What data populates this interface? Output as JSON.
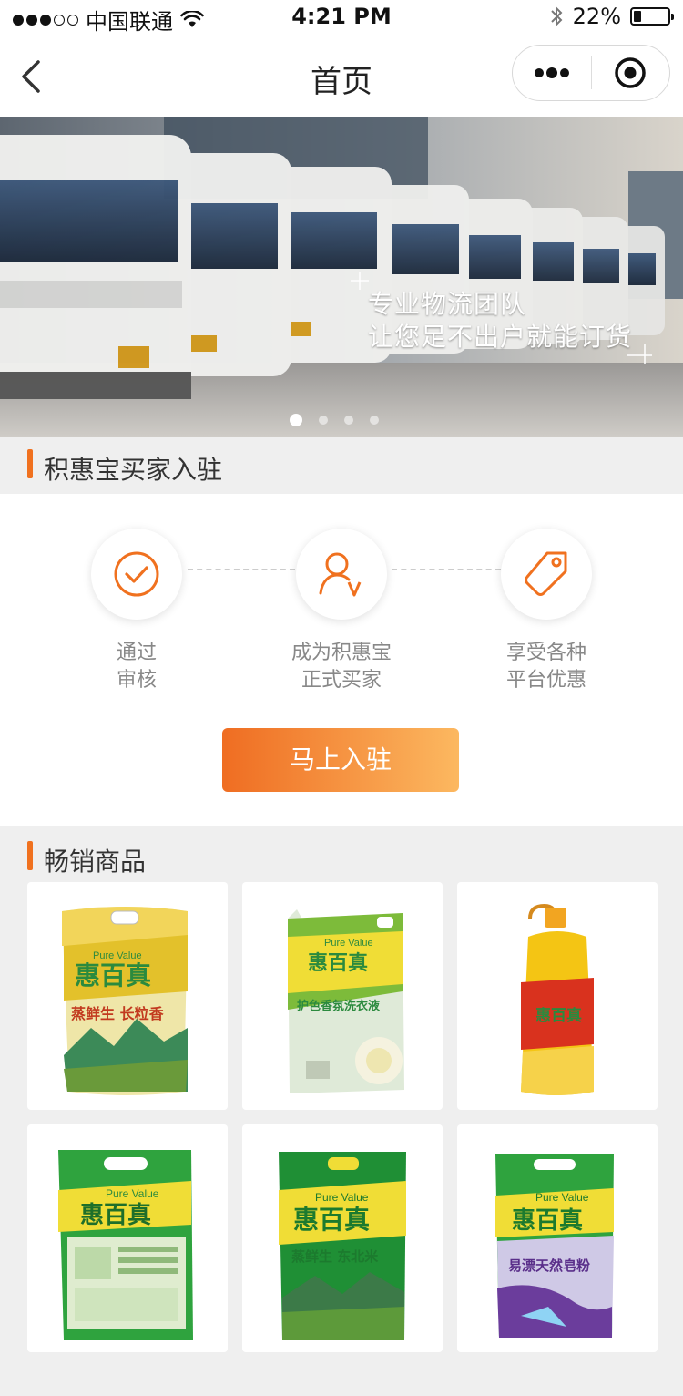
{
  "status_bar": {
    "carrier": "中国联通",
    "time": "4:21 PM",
    "battery_percent": "22%",
    "battery_level": 0.22,
    "signal_bars": 3,
    "signal_total": 5
  },
  "navbar": {
    "title": "首页",
    "back_icon": "chevron-left-icon",
    "more_icon": "more-dots-icon",
    "close_icon": "target-icon"
  },
  "banner": {
    "line1": "专业物流团队",
    "line2": "让您足不出户就能订货",
    "slide_count": 4,
    "active_index": 0
  },
  "join_section": {
    "title": "积惠宝买家入驻",
    "steps": [
      {
        "icon": "check-circle-icon",
        "line1": "通过",
        "line2": "审核"
      },
      {
        "icon": "user-v-icon",
        "line1": "成为积惠宝",
        "line2": "正式买家"
      },
      {
        "icon": "price-tag-icon",
        "line1": "享受各种",
        "line2": "平台优惠"
      }
    ],
    "button_label": "马上入驻"
  },
  "products_section": {
    "title": "畅销商品",
    "items": [
      {
        "kind": "rice-bag",
        "brand_en": "Pure Value",
        "brand": "惠百真",
        "label": "蒸鲜生 长粒香",
        "accent": "#c23a1f"
      },
      {
        "kind": "pouch",
        "brand_en": "Pure Value",
        "brand": "惠百真",
        "label": "护色香氛洗衣液",
        "accent": "#2b8a3e"
      },
      {
        "kind": "oil-bottle",
        "brand_en": "",
        "brand": "惠百真",
        "label": "",
        "accent": "#e8b400"
      },
      {
        "kind": "powder-bag",
        "brand_en": "Pure Value",
        "brand": "惠百真",
        "label": "",
        "accent": "#2b8a3e"
      },
      {
        "kind": "rice-bag-green",
        "brand_en": "Pure Value",
        "brand": "惠百真",
        "label": "蒸鲜生 东北米",
        "accent": "#1c7a2e"
      },
      {
        "kind": "soap-bag",
        "brand_en": "Pure Value",
        "brand": "惠百真",
        "label": "易漂天然皂粉",
        "accent": "#5a2f8a"
      }
    ]
  },
  "colors": {
    "accent": "#f0711f",
    "gradient_start": "#ef6d22",
    "gradient_end": "#fcb860",
    "bg": "#efefef"
  }
}
